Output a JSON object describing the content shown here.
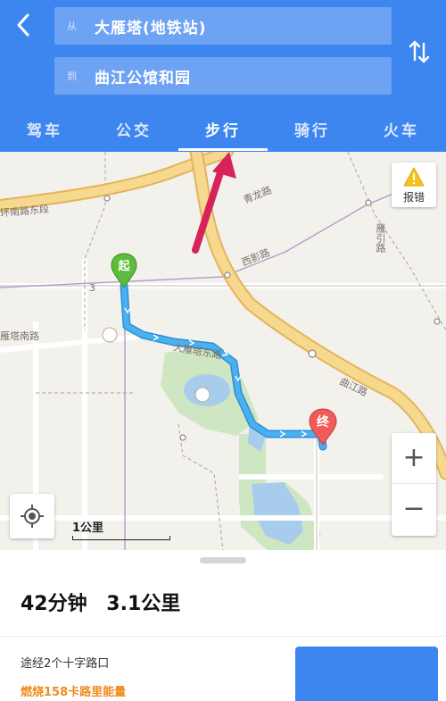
{
  "header": {
    "from": {
      "prefix": "从",
      "value": "大雁塔(地铁站)"
    },
    "to": {
      "prefix": "到",
      "value": "曲江公馆和园"
    }
  },
  "tabs": [
    {
      "label": "驾车"
    },
    {
      "label": "公交"
    },
    {
      "label": "步行",
      "active": true
    },
    {
      "label": "骑行"
    },
    {
      "label": "火车"
    }
  ],
  "map": {
    "labels": {
      "ring_road": "环南路东段",
      "qinglong_road": "青龙路",
      "yanying_road": "雁引路",
      "xiying_road": "西影路",
      "yanta_east": "大雁塔东路",
      "yanta_south": "雁塔南路",
      "qujiang_road": "曲江路",
      "road_3": "3"
    },
    "start_marker": "起",
    "end_marker": "终",
    "report_label": "报错",
    "zoom_in": "+",
    "zoom_out": "−",
    "scale_text": "1公里"
  },
  "route_summary": {
    "duration": "42分钟",
    "distance": "3.1公里",
    "via": "途经2个十字路口",
    "calories": "燃烧158卡路里能量"
  },
  "colors": {
    "brand_blue": "#3d86f0",
    "route": "#4ab0ee",
    "calories": "#f08a1c",
    "start_marker": "#5bbd3a",
    "end_marker": "#f05a5a",
    "annotation_arrow": "#d6245b"
  },
  "icons": {
    "back": "chevron-left-icon",
    "swap": "swap-vertical-icon",
    "report": "warning-icon",
    "locate": "crosshair-icon"
  }
}
